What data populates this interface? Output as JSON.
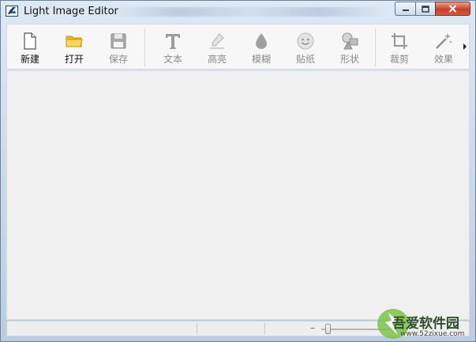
{
  "window": {
    "title": "Light Image Editor",
    "controls": [
      "minimize",
      "maximize",
      "close"
    ]
  },
  "toolbar": {
    "tools": [
      {
        "id": "new",
        "label": "新建",
        "icon": "new-file-icon",
        "enabled": true
      },
      {
        "id": "open",
        "label": "打开",
        "icon": "folder-icon",
        "enabled": true
      },
      {
        "id": "save",
        "label": "保存",
        "icon": "floppy-disk-icon",
        "enabled": false
      },
      {
        "id": "text",
        "label": "文本",
        "icon": "text-t-icon",
        "enabled": false
      },
      {
        "id": "highlight",
        "label": "高亮",
        "icon": "highlighter-pen-icon",
        "enabled": false
      },
      {
        "id": "blur",
        "label": "模糊",
        "icon": "water-drop-icon",
        "enabled": false
      },
      {
        "id": "sticker",
        "label": "贴纸",
        "icon": "smiley-face-icon",
        "enabled": false
      },
      {
        "id": "shape",
        "label": "形状",
        "icon": "shapes-icon",
        "enabled": false
      },
      {
        "id": "crop",
        "label": "裁剪",
        "icon": "crop-icon",
        "enabled": false
      },
      {
        "id": "effect",
        "label": "效果",
        "icon": "magic-wand-icon",
        "enabled": false
      }
    ],
    "overflow_icon": "chevron-right-icon"
  },
  "statusbar": {
    "zoom_minus": "–",
    "zoom_level_fraction": 0.05
  },
  "watermark": {
    "text": "吾爱软件园",
    "url": "www.52zixue.com"
  },
  "colors": {
    "title_gradient_top": "#dde9f5",
    "toolbar_bg": "#f7f7f7",
    "canvas_bg": "#f0f0f0",
    "open_folder": "#f4c430",
    "close_button": "#c7422b"
  }
}
